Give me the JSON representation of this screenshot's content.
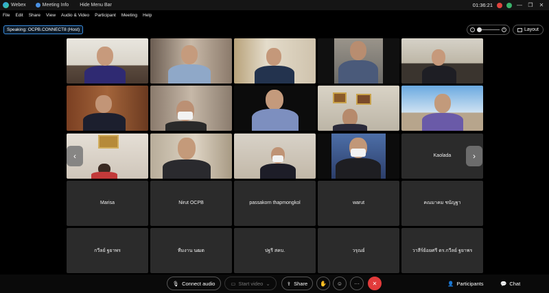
{
  "titlebar": {
    "app": "Webex",
    "meeting_info": "Meeting Info",
    "hide_menu": "Hide Menu Bar",
    "time": "01:36:21",
    "min": "—",
    "max": "❐",
    "close": "✕"
  },
  "menu": [
    "File",
    "Edit",
    "Share",
    "View",
    "Audio & Video",
    "Participant",
    "Meeting",
    "Help"
  ],
  "speaking": "Speaking: OCPB.CONNECT8 (Host)",
  "layout_label": "Layout",
  "zoom_level": 0,
  "name_tiles": {
    "kaolada": "Kaolada",
    "r4": [
      "Marisa",
      "Nirut OCPB",
      "passakorn thapmongkol",
      "warut",
      "คณมาคม ชนัญฐา"
    ],
    "r5": [
      "กวีลย์ ฐยาพร",
      "ทีมงาน นฒต",
      "ปฐรี สคบ.",
      "วรุณย์",
      "วาสีร์ย้อยศรี ดร.กวีลย์ ฐยาพร"
    ]
  },
  "controls": {
    "connect_audio": "Connect audio",
    "start_video": "Start video",
    "share": "Share",
    "participants": "Participants",
    "chat": "Chat"
  },
  "icons": {
    "arrow_left": "‹",
    "arrow_right": "›",
    "more": "···",
    "end": "✕"
  }
}
